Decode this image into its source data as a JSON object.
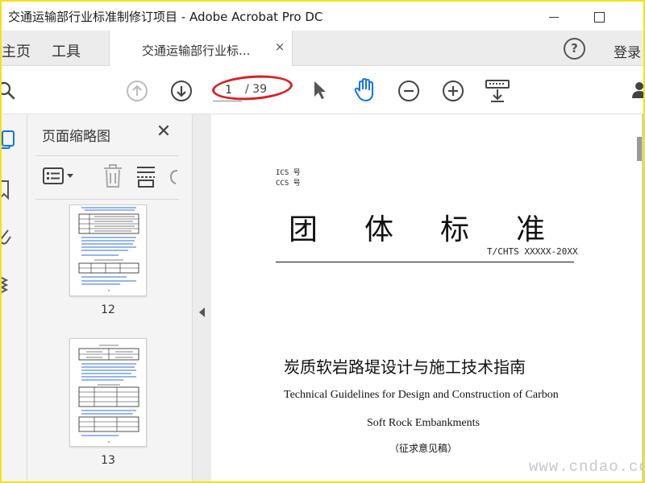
{
  "window": {
    "title": "交通运输部行业标准制修订项目 - Adobe Acrobat Pro DC"
  },
  "tabbar": {
    "home_label": "主页",
    "tools_label": "工具",
    "doc_tab_label": "交通运输部行业标...",
    "doc_tab_close": "×",
    "help_label": "?",
    "login_label": "登录"
  },
  "toolbar": {
    "current_page": "1",
    "page_total": "/ 39",
    "icons": [
      "search-icon",
      "prev-page-icon",
      "next-page-icon",
      "select-pointer-icon",
      "hand-tool-icon",
      "zoom-out-icon",
      "zoom-in-icon",
      "keyboard-scroll-icon",
      "user-icon"
    ],
    "accent_color": "#1473e6",
    "annotation_color": "#d42222"
  },
  "side_panel": {
    "title": "页面缩略图",
    "close_label": "✕",
    "thumbnails": [
      {
        "label": "12"
      },
      {
        "label": "13"
      }
    ]
  },
  "document": {
    "ics_line": "ICS 号",
    "ccs_line": "CCS 号",
    "big_heading": "团体标准",
    "standard_code": "T/CHTS XXXXX-20XX",
    "title_cn": "炭质软岩路堤设计与施工技术指南",
    "title_en_line1": "Technical Guidelines for Design and Construction of Carbon",
    "title_en_line2": "Soft Rock Embankments",
    "draft_note": "（征求意见稿）"
  },
  "watermark": "www.cndao.com",
  "colors": {
    "frame": "#f5e11a",
    "tab_bar": "#ececec",
    "panel": "#f4f4f4",
    "thumb_text_blue": "#2b6fd6"
  }
}
